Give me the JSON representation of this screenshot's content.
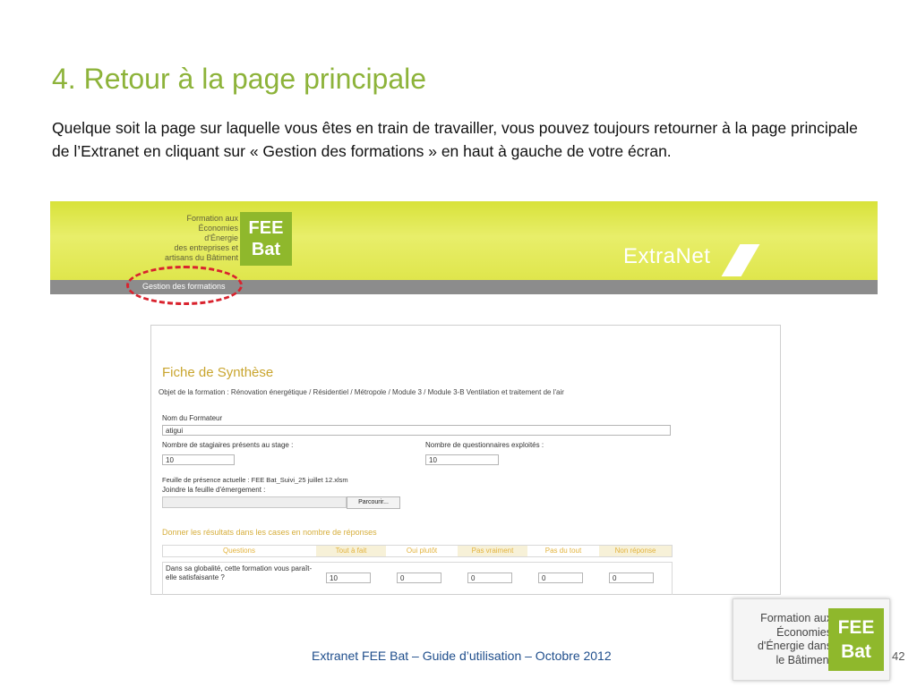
{
  "slide": {
    "title": "4. Retour à la page principale",
    "intro": "Quelque soit la page sur laquelle vous êtes en train de travailler, vous pouvez toujours retourner à la page principale de l’Extranet en cliquant sur « Gestion des formations » en haut à gauche de votre écran.",
    "footer": "Extranet FEE Bat – Guide d’utilisation – Octobre 2012",
    "page_number": "42"
  },
  "banner": {
    "logo_lines": [
      "Formation aux",
      "Économies",
      "d'Énergie",
      "des entreprises et",
      "artisans du Bâtiment"
    ],
    "logo_box": [
      "FEE",
      "Bat"
    ],
    "extranet": "ExtraNet",
    "nav_link": "Gestion des formations"
  },
  "form": {
    "title": "Fiche de Synthèse",
    "subtitle": "Objet de la formation : Rénovation énergétique / Résidentiel / Métropole / Module 3 / Module 3-B Ventilation et traitement de l'air",
    "trainer_label": "Nom du Formateur",
    "trainer_value": "atigui",
    "trainees_label": "Nombre de stagiaires présents au stage :",
    "trainees_value": "10",
    "questionnaires_label": "Nombre de questionnaires exploités :",
    "questionnaires_value": "10",
    "presence_label": "Feuille de présence actuelle : FEE Bat_Suivi_25 juillet 12.xlsm",
    "attach_label": "Joindre la feuille d'émergement :",
    "browse_button": "Parcourir...",
    "results_heading": "Donner les résultats dans les cases en nombre de réponses",
    "columns": [
      "Questions",
      "Tout à fait",
      "Oui plutôt",
      "Pas vraiment",
      "Pas du tout",
      "Non réponse"
    ],
    "question_1": "Dans sa globalité, cette formation vous paraît-elle satisfaisante ?",
    "answers_1": [
      "10",
      "0",
      "0",
      "0",
      "0"
    ]
  },
  "corner_logo": {
    "lines": [
      "Formation aux",
      "Économies",
      "d'Énergie dans",
      "le Bâtiment"
    ],
    "box": [
      "FEE",
      "Bat"
    ]
  },
  "colors": {
    "title_green": "#8DB33A",
    "banner_yellow": "#dfe64c",
    "logo_green": "#8fb82c",
    "highlight_red": "#d9232e",
    "footer_blue": "#1f4e8c"
  }
}
